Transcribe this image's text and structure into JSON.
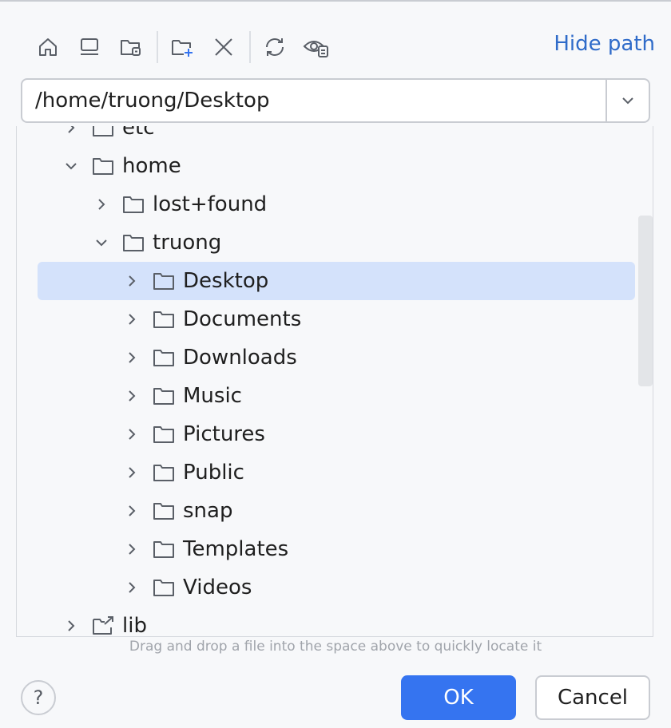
{
  "toolbar": {
    "icons": [
      "home-icon",
      "desktop-icon",
      "project-folder-icon",
      "new-folder-icon",
      "delete-icon",
      "refresh-icon",
      "show-hidden-icon"
    ],
    "hide_path_label": "Hide path"
  },
  "path": {
    "value": "/home/truong/Desktop"
  },
  "tree": {
    "items": [
      {
        "label": "etc",
        "expanded": false,
        "icon": "folder-icon"
      },
      {
        "label": "home",
        "expanded": true,
        "icon": "folder-icon"
      },
      {
        "label": "lost+found",
        "expanded": false,
        "icon": "folder-icon"
      },
      {
        "label": "truong",
        "expanded": true,
        "icon": "folder-icon"
      },
      {
        "label": "Desktop",
        "expanded": false,
        "icon": "folder-icon",
        "selected": true
      },
      {
        "label": "Documents",
        "expanded": false,
        "icon": "folder-icon"
      },
      {
        "label": "Downloads",
        "expanded": false,
        "icon": "folder-icon"
      },
      {
        "label": "Music",
        "expanded": false,
        "icon": "folder-icon"
      },
      {
        "label": "Pictures",
        "expanded": false,
        "icon": "folder-icon"
      },
      {
        "label": "Public",
        "expanded": false,
        "icon": "folder-icon"
      },
      {
        "label": "snap",
        "expanded": false,
        "icon": "folder-icon"
      },
      {
        "label": "Templates",
        "expanded": false,
        "icon": "folder-icon"
      },
      {
        "label": "Videos",
        "expanded": false,
        "icon": "folder-icon"
      },
      {
        "label": "lib",
        "expanded": false,
        "icon": "symlink-folder-icon"
      }
    ]
  },
  "hint": "Drag and drop a file into the space above to quickly locate it",
  "buttons": {
    "help_label": "?",
    "ok_label": "OK",
    "cancel_label": "Cancel"
  },
  "colors": {
    "accent": "#3574f0",
    "link": "#2f6bc9",
    "selection": "#d4e2fb"
  }
}
